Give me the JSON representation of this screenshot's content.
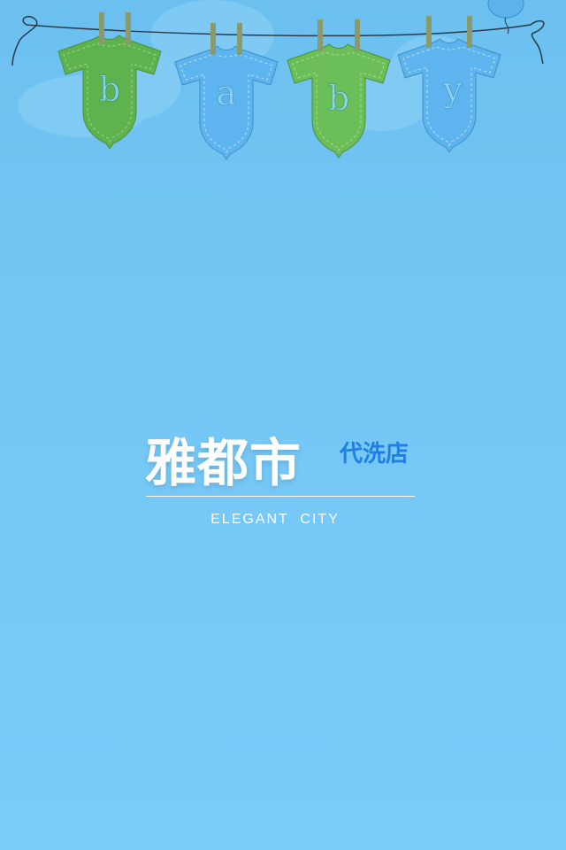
{
  "banner": {
    "letters": [
      "b",
      "a",
      "b",
      "y"
    ]
  },
  "brand": {
    "name": "雅都市",
    "tagline": "代洗店",
    "english": "ELEGANT  CITY"
  },
  "colors": {
    "background": "#74c6f4",
    "shirt_green": "#66bb55",
    "shirt_blue": "#66b8ee",
    "tagline": "#1f7fe8"
  }
}
